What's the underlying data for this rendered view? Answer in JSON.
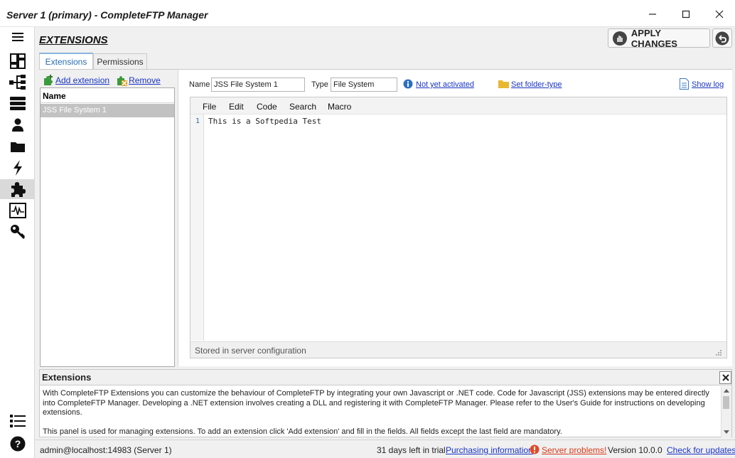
{
  "window": {
    "title": "Server 1 (primary) - CompleteFTP Manager",
    "minimize_icon": "minimize-icon",
    "maximize_icon": "maximize-icon",
    "close_icon": "close-icon"
  },
  "sidebar": {
    "items": [
      {
        "name": "menu",
        "icon": "hamburger-icon"
      },
      {
        "name": "dashboard",
        "icon": "dashboard-icon"
      },
      {
        "name": "sites",
        "icon": "network-icon"
      },
      {
        "name": "servers",
        "icon": "server-icon"
      },
      {
        "name": "users",
        "icon": "user-icon"
      },
      {
        "name": "folders",
        "icon": "folder-icon"
      },
      {
        "name": "events",
        "icon": "lightning-icon"
      },
      {
        "name": "extensions",
        "icon": "puzzle-icon",
        "active": true
      },
      {
        "name": "monitoring",
        "icon": "monitor-icon"
      },
      {
        "name": "security",
        "icon": "key-icon"
      },
      {
        "name": "list",
        "icon": "list-icon"
      },
      {
        "name": "help",
        "icon": "help-icon"
      }
    ]
  },
  "header": {
    "page_title": "EXTENSIONS",
    "apply_label": "APPLY CHANGES"
  },
  "tabs": [
    {
      "label": "Extensions",
      "active": true
    },
    {
      "label": "Permissions",
      "active": false
    }
  ],
  "list_toolbar": {
    "add_label": "Add extension",
    "remove_label": "Remove"
  },
  "extensions_list": {
    "header": "Name",
    "rows": [
      "JSS File System 1"
    ]
  },
  "details": {
    "name_label": "Name",
    "name_value": "JSS File System 1",
    "type_label": "Type",
    "type_value": "File System",
    "activation_link": "Not yet activated",
    "folder_type_link": "Set folder-type",
    "show_log_link": "Show log"
  },
  "editor": {
    "menu": [
      "File",
      "Edit",
      "Code",
      "Search",
      "Macro"
    ],
    "line_number": "1",
    "code_line": "This is a Softpedia Test",
    "status": "Stored in server configuration"
  },
  "info_panel": {
    "title": "Extensions",
    "paragraph1": "With CompleteFTP Extensions you can customize the behaviour of CompleteFTP by integrating your own Javascript or .NET code.  Code for Javascript (JSS) extensions may be entered directly into CompleteFTP Manager.  Developing a .NET extension involves creating a DLL and registering it with CompleteFTP Manager.  Please refer to the User's Guide for instructions on developing extensions.",
    "paragraph2": "This panel is used for managing extensions.  To add an extension click 'Add extension' and fill in the fields.  All fields except the last field are mandatory."
  },
  "status_bar": {
    "connection": "admin@localhost:14983 (Server 1)",
    "trial": "31 days left in trial",
    "purchasing": "Purchasing information",
    "problems": "Server problems!",
    "version": "Version 10.0.0",
    "updates": "Check for updates"
  },
  "colors": {
    "link": "#1a35c4",
    "error": "#d93b1b",
    "tab_active": "#2a6db0"
  }
}
